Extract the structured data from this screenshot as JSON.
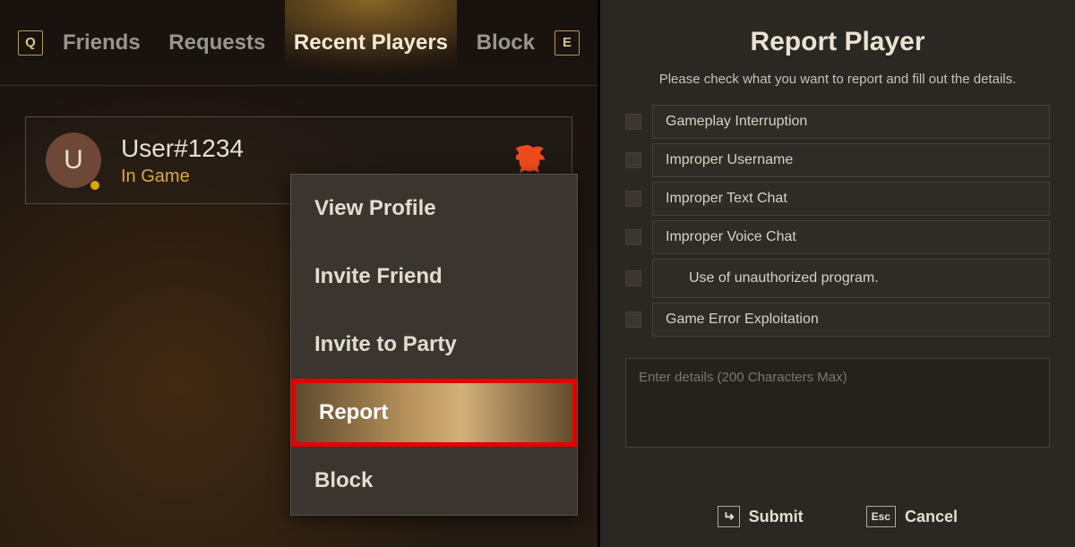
{
  "nav": {
    "key_prev": "Q",
    "key_next": "E",
    "tabs": [
      "Friends",
      "Requests",
      "Recent Players",
      "Block"
    ],
    "active_index": 2
  },
  "player": {
    "avatar_initial": "U",
    "name": "User#1234",
    "status": "In Game",
    "presence_color": "#e0a400"
  },
  "context_menu": {
    "items": [
      "View Profile",
      "Invite Friend",
      "Invite to Party",
      "Report",
      "Block"
    ],
    "highlight_index": 3
  },
  "report": {
    "title": "Report Player",
    "subtitle": "Please check what you want to report and fill out the details.",
    "reasons": [
      "Gameplay Interruption",
      "Improper Username",
      "Improper Text Chat",
      "Improper Voice Chat",
      "Use of unauthorized program.",
      "Game Error Exploitation"
    ],
    "details_placeholder": "Enter details (200 Characters Max)",
    "submit": {
      "key": "Enter",
      "label": "Submit"
    },
    "cancel": {
      "key": "Esc",
      "label": "Cancel"
    }
  }
}
